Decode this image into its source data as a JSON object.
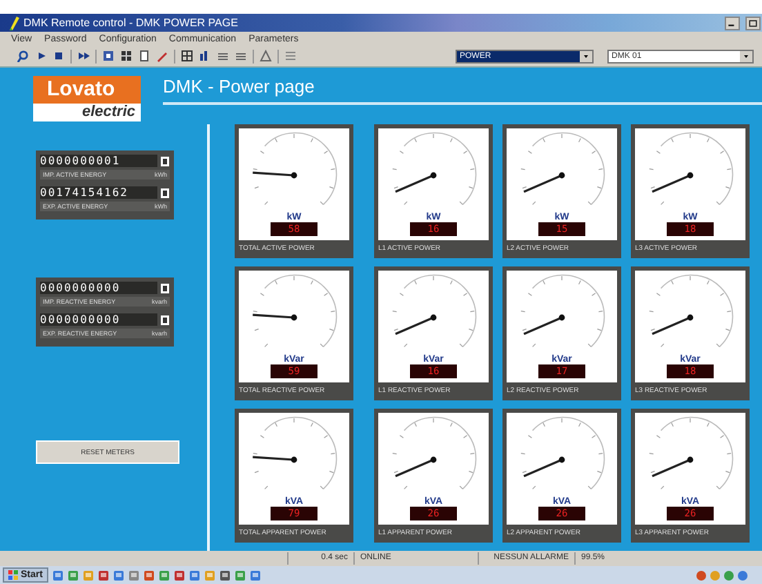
{
  "window": {
    "title": "DMK Remote control - DMK POWER PAGE"
  },
  "menu": [
    "View",
    "Password",
    "Configuration",
    "Communication",
    "Parameters"
  ],
  "toolbar": {
    "page_select": "POWER",
    "device_select": "DMK 01"
  },
  "logo": {
    "line_1": "Lovato",
    "line_2": "electric"
  },
  "page_title": "DMK - Power page",
  "counters": [
    {
      "digits": "0000000001",
      "label": "IMP. ACTIVE ENERGY",
      "unit": "kWh"
    },
    {
      "digits": "00174154162",
      "label": "EXP. ACTIVE ENERGY",
      "unit": "kWh"
    },
    {
      "digits": "0000000000",
      "label": "IMP. REACTIVE ENERGY",
      "unit": "kvarh"
    },
    {
      "digits": "0000000000",
      "label": "EXP. REACTIVE ENERGY",
      "unit": "kvarh"
    }
  ],
  "reset_button": "RESET METERS",
  "gauges": [
    {
      "unit": "kW",
      "value": "58",
      "label": "TOTAL ACTIVE POWER"
    },
    {
      "unit": "kW",
      "value": "16",
      "label": "L1 ACTIVE POWER"
    },
    {
      "unit": "kW",
      "value": "15",
      "label": "L2 ACTIVE POWER"
    },
    {
      "unit": "kW",
      "value": "18",
      "label": "L3 ACTIVE POWER"
    },
    {
      "unit": "kVar",
      "value": "59",
      "label": "TOTAL REACTIVE POWER"
    },
    {
      "unit": "kVar",
      "value": "16",
      "label": "L1 REACTIVE POWER"
    },
    {
      "unit": "kVar",
      "value": "17",
      "label": "L2 REACTIVE POWER"
    },
    {
      "unit": "kVar",
      "value": "18",
      "label": "L3 REACTIVE POWER"
    },
    {
      "unit": "kVA",
      "value": "79",
      "label": "TOTAL APPARENT POWER"
    },
    {
      "unit": "kVA",
      "value": "26",
      "label": "L1 APPARENT POWER"
    },
    {
      "unit": "kVA",
      "value": "26",
      "label": "L2 APPARENT POWER"
    },
    {
      "unit": "kVA",
      "value": "26",
      "label": "L3 APPARENT POWER"
    }
  ],
  "status_bar": [
    "0.4 sec",
    "ONLINE",
    "NESSUN ALLARME",
    "99.5%"
  ],
  "taskbar": {
    "start": "Start"
  }
}
